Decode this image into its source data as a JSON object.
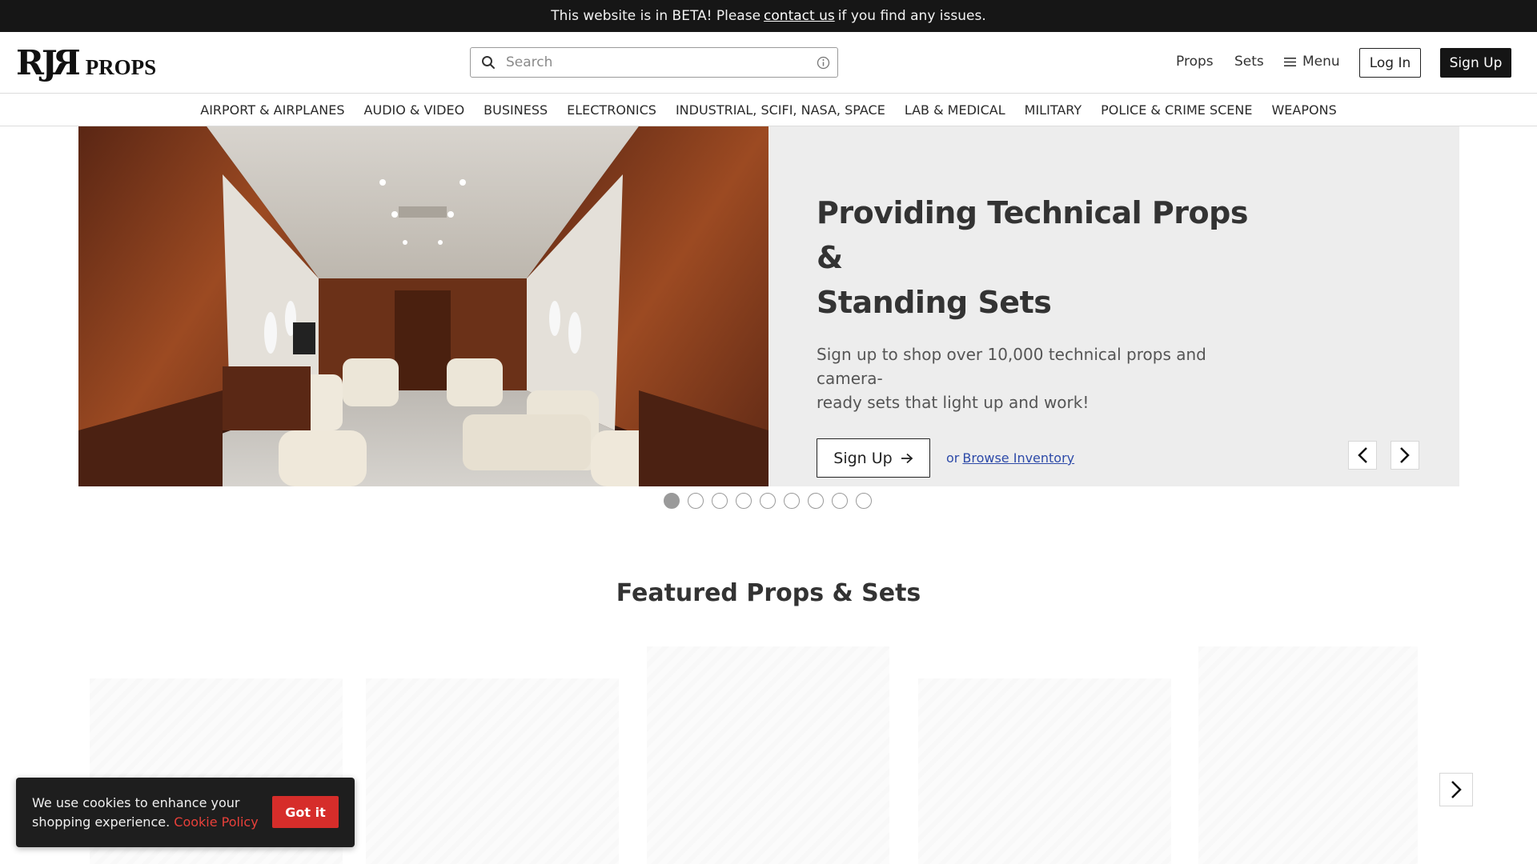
{
  "beta_bar": {
    "text_before": "This website is in BETA! Please",
    "link": "contact us",
    "text_after": "if you find any issues."
  },
  "header": {
    "logo_mark": "RJ",
    "logo_mark_rev": "R",
    "logo_text": "PROPS",
    "search_placeholder": "Search",
    "nav": {
      "props": "Props",
      "sets": "Sets",
      "menu": "Menu"
    },
    "login": "Log In",
    "signup": "Sign Up"
  },
  "categories": [
    "AIRPORT & AIRPLANES",
    "AUDIO & VIDEO",
    "BUSINESS",
    "ELECTRONICS",
    "INDUSTRIAL, SCIFI, NASA, SPACE",
    "LAB & MEDICAL",
    "MILITARY",
    "POLICE & CRIME SCENE",
    "WEAPONS"
  ],
  "hero": {
    "title_line1": "Providing Technical Props &",
    "title_line2": "Standing Sets",
    "subtitle_line1": "Sign up to shop over 10,000 technical props and camera-",
    "subtitle_line2": "ready sets that light up and work!",
    "signup_label": "Sign Up",
    "or": "or",
    "browse_link": "Browse Inventory"
  },
  "carousel": {
    "slide_count": 9,
    "active_index": 0
  },
  "featured": {
    "title": "Featured Props & Sets"
  },
  "cookie": {
    "text": "We use cookies to enhance your shopping experience.",
    "policy_link": "Cookie Policy",
    "button": "Got it"
  },
  "colors": {
    "topbar": "#161616",
    "accent_red": "#d62d2a",
    "link_blue": "#2d4aa8",
    "hero_bg": "#ededed"
  }
}
